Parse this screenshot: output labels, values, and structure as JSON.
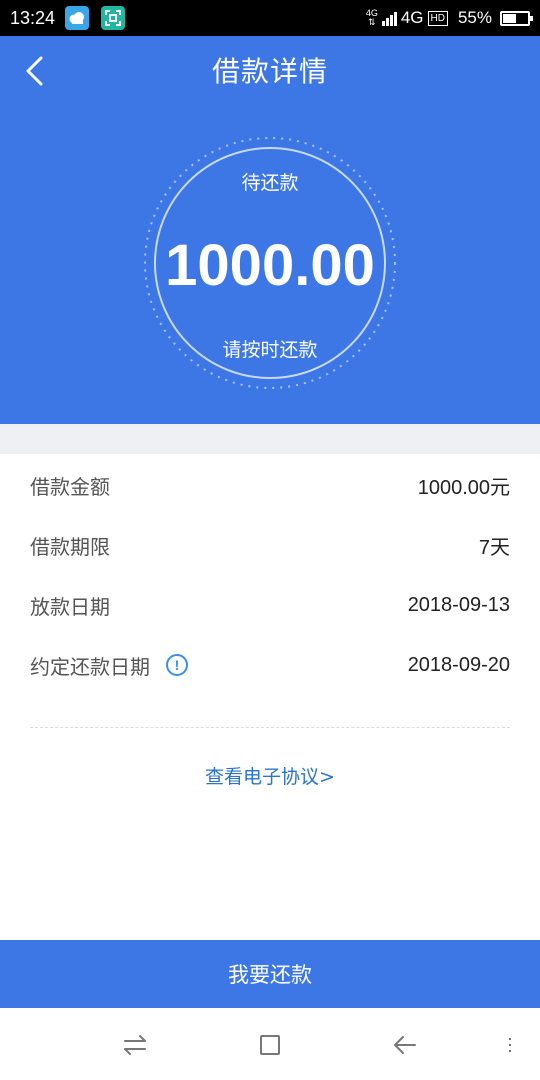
{
  "status_bar": {
    "time": "13:24",
    "network_small": "4G",
    "network": "4G",
    "hd": "HD",
    "battery": "55%",
    "battery_level": 0.55,
    "app_icons": [
      "weather-app-icon",
      "scanner-app-icon"
    ]
  },
  "header": {
    "title": "借款详情",
    "back_icon": "chevron-left-icon"
  },
  "summary": {
    "label": "待还款",
    "amount": "1000.00",
    "note": "请按时还款"
  },
  "details": [
    {
      "label": "借款金额",
      "value": "1000.00元"
    },
    {
      "label": "借款期限",
      "value": "7天"
    },
    {
      "label": "放款日期",
      "value": "2018-09-13"
    },
    {
      "label": "约定还款日期",
      "value": "2018-09-20",
      "info_icon": "info-icon"
    }
  ],
  "agreement_link": "查看电子协议>",
  "repay_button": "我要还款",
  "nav": [
    "switch-apps-icon",
    "home-square-icon",
    "back-arrow-icon",
    "menu-icon"
  ],
  "colors": {
    "primary": "#3d77e6",
    "link": "#2b74cc",
    "info": "#3b8ee6",
    "gap": "#eef0f4"
  }
}
